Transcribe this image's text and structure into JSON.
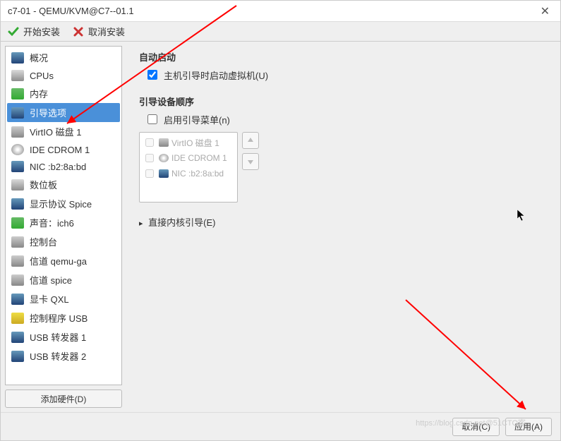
{
  "window": {
    "title": "c7-01 - QEMU/KVM@C7--01.1"
  },
  "toolbar": {
    "start_install": "开始安装",
    "cancel_install": "取消安装"
  },
  "sidebar": {
    "items": [
      {
        "label": "概况",
        "icon": "blue"
      },
      {
        "label": "CPUs",
        "icon": "gray"
      },
      {
        "label": "内存",
        "icon": "green"
      },
      {
        "label": "引导选项",
        "icon": "blue",
        "selected": true
      },
      {
        "label": "VirtIO 磁盘 1",
        "icon": "disk"
      },
      {
        "label": "IDE CDROM 1",
        "icon": "cd"
      },
      {
        "label": "NIC :b2:8a:bd",
        "icon": "blue"
      },
      {
        "label": "数位板",
        "icon": "gray"
      },
      {
        "label": "显示协议 Spice",
        "icon": "blue"
      },
      {
        "label": "声音：ich6",
        "icon": "green"
      },
      {
        "label": "控制台",
        "icon": "disk"
      },
      {
        "label": "信道 qemu-ga",
        "icon": "disk"
      },
      {
        "label": "信道 spice",
        "icon": "disk"
      },
      {
        "label": "显卡 QXL",
        "icon": "blue"
      },
      {
        "label": "控制程序 USB",
        "icon": "gold"
      },
      {
        "label": "USB 转发器 1",
        "icon": "blue"
      },
      {
        "label": "USB 转发器 2",
        "icon": "blue"
      }
    ],
    "add_hardware": "添加硬件(D)"
  },
  "content": {
    "autostart_title": "自动启动",
    "autostart_checkbox": "主机引导时启动虚拟机(U)",
    "autostart_checked": true,
    "bootorder_title": "引导设备顺序",
    "bootmenu_checkbox": "启用引导菜单(n)",
    "bootmenu_checked": false,
    "devices": [
      {
        "label": "VirtIO 磁盘 1",
        "icon": "disk"
      },
      {
        "label": "IDE CDROM 1",
        "icon": "cd"
      },
      {
        "label": "NIC :b2:8a:bd",
        "icon": "blue"
      }
    ],
    "direct_kernel": "直接内核引导(E)"
  },
  "footer": {
    "cancel": "取消(C)",
    "apply": "应用(A)"
  },
  "watermark": "https://blog.csdn.net@51CTO客"
}
